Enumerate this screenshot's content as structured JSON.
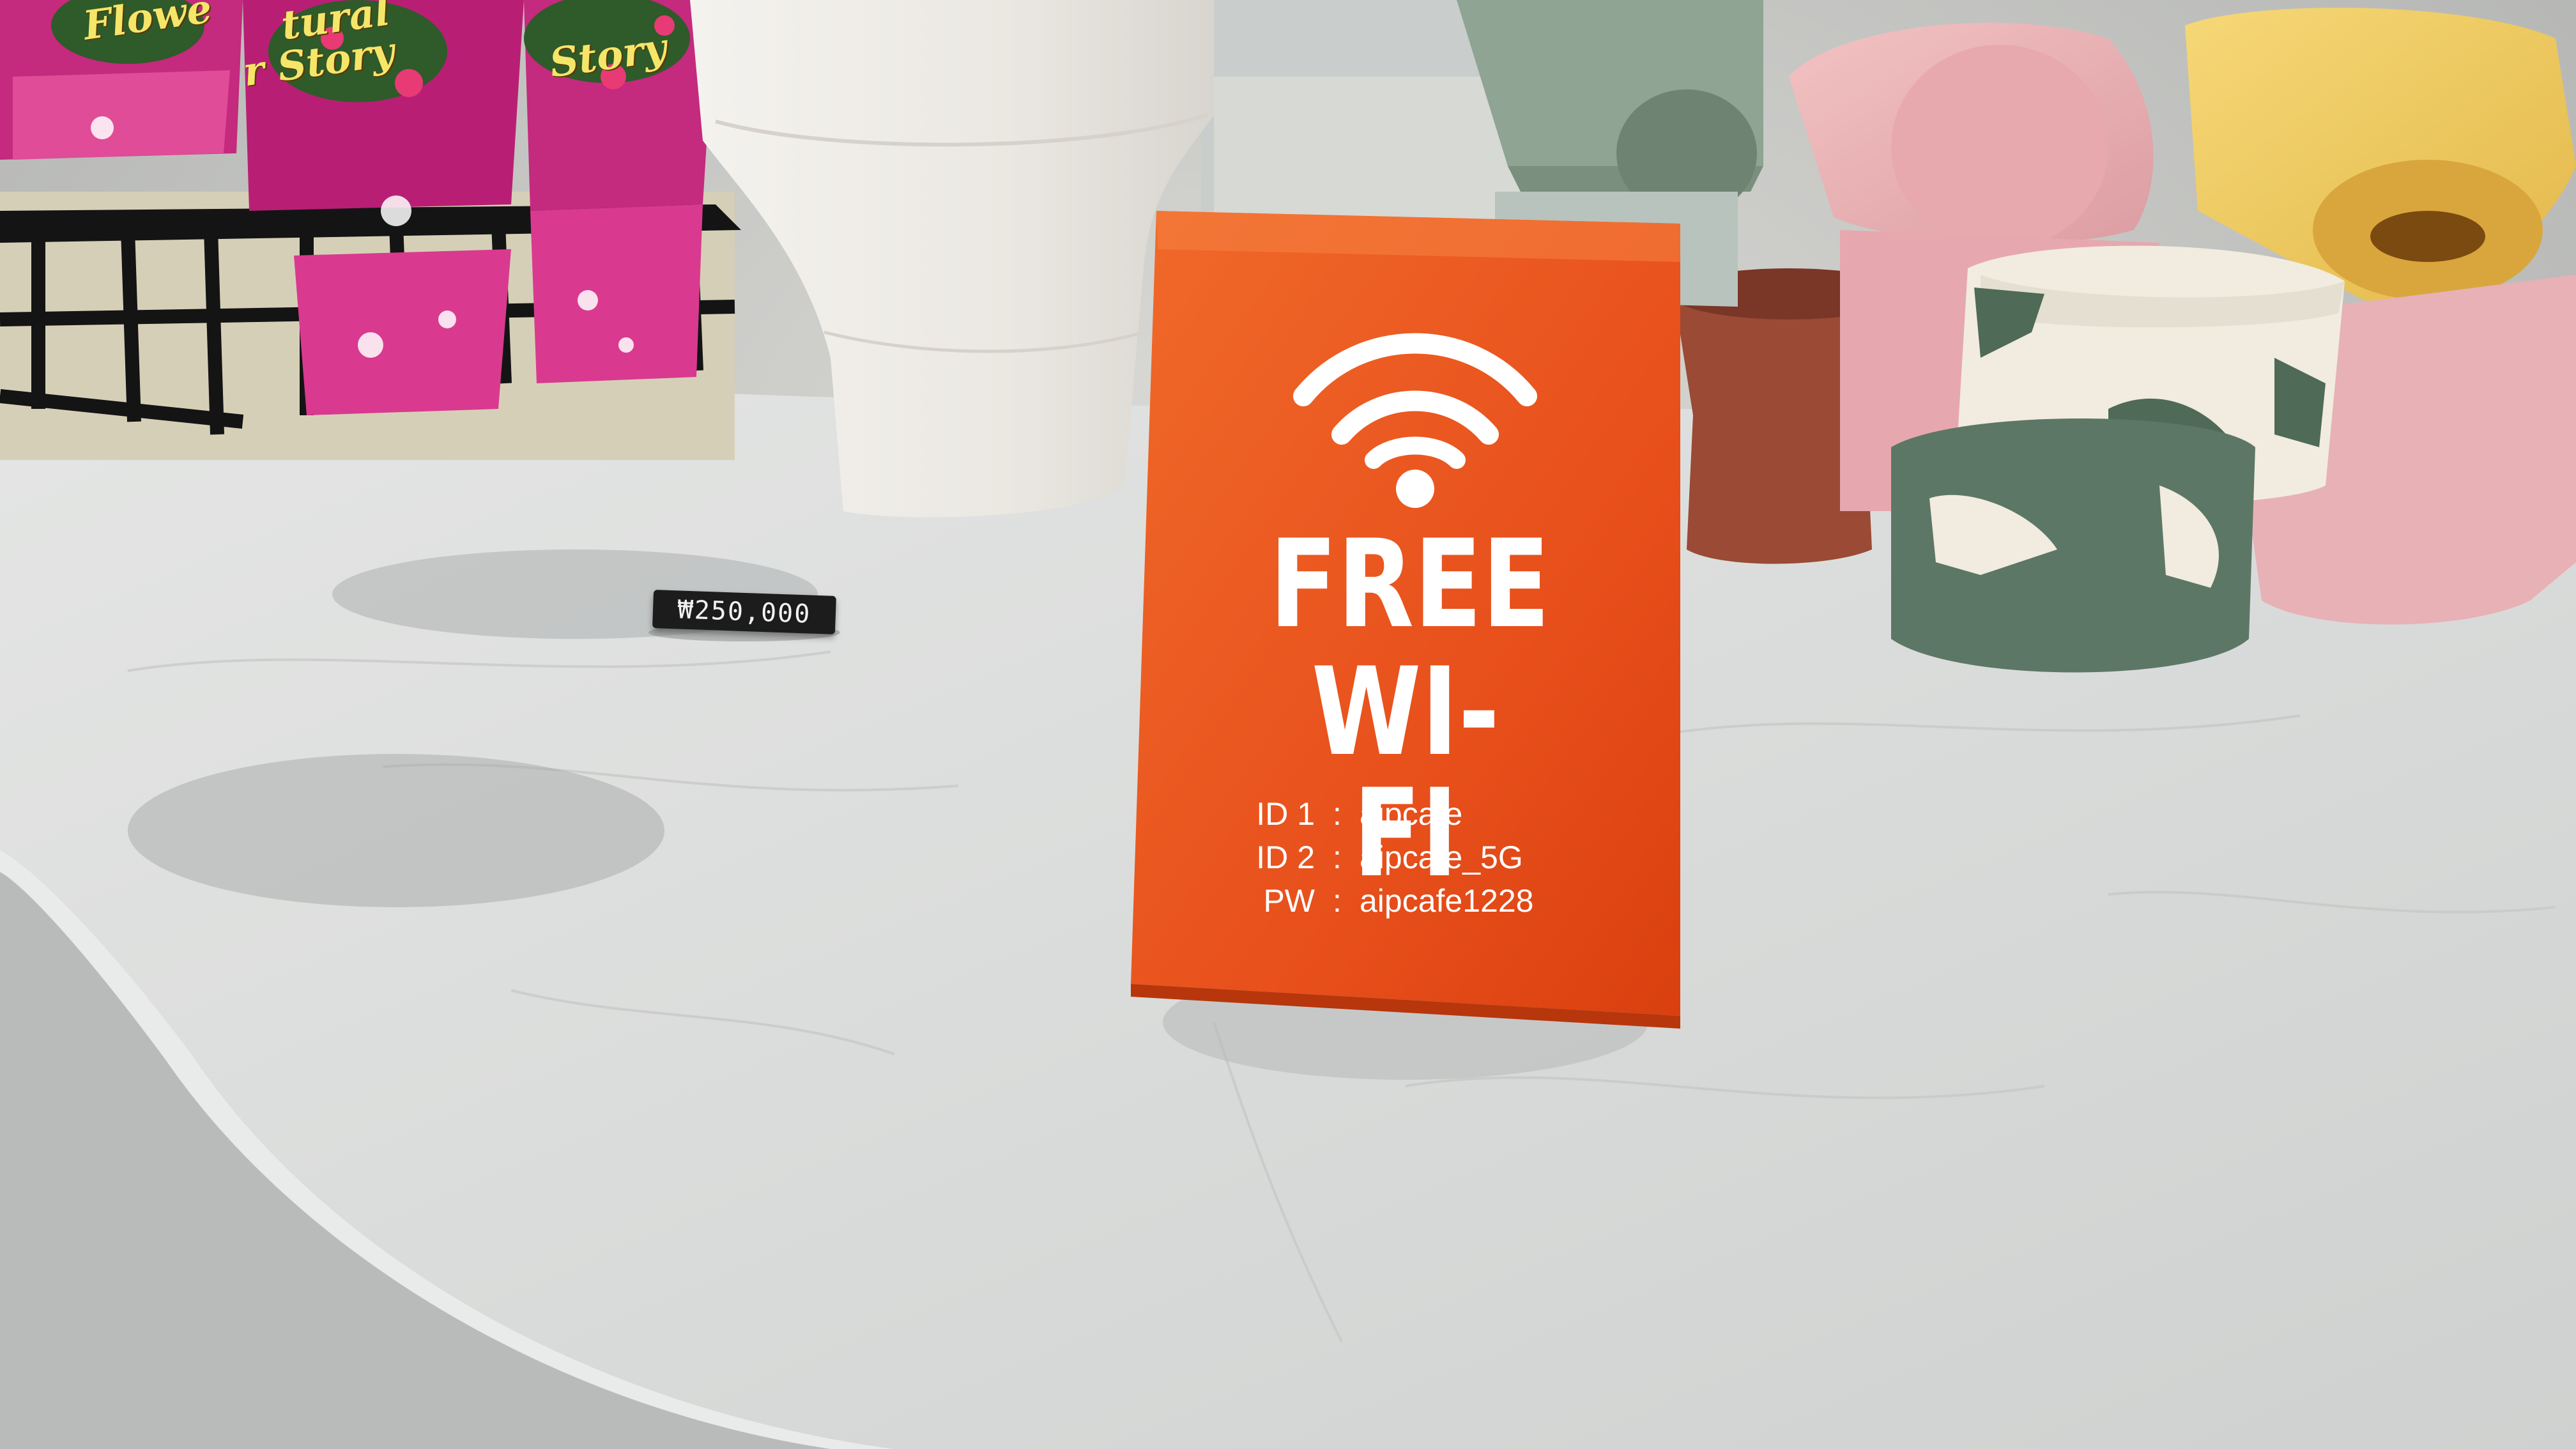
{
  "sign": {
    "free": "FREE",
    "wifi": "WI-FI",
    "credentials": [
      {
        "key": "ID 1",
        "value": "aipcafe"
      },
      {
        "key": "ID 2",
        "value": "aipcafe_5G"
      },
      {
        "key": "PW",
        "value": "aipcafe1228"
      }
    ],
    "separator": ":",
    "color": "#e8531f"
  },
  "price_tag": {
    "text": "₩250,000"
  },
  "plant_wrap_text": {
    "line1": "Flowe",
    "line2": "tural",
    "line3": "r Story",
    "line4": "Story"
  },
  "colors": {
    "counter": "#dfe0df",
    "pot_pink": "#e9aeb4",
    "pot_green": "#8fa493",
    "pot_yellow": "#eecb5c",
    "pot_terracotta": "#9a4a35"
  }
}
